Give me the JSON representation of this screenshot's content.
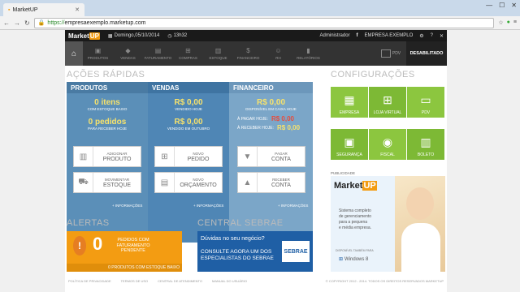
{
  "browser": {
    "tab_title": "MarketUP",
    "url_scheme": "https://",
    "url_host": "empresaexemplo.marketup.com"
  },
  "topbar": {
    "logo_text": "Market",
    "logo_up": "UP",
    "date": "Domingo,05/10/2014",
    "time": "13h32",
    "user": "Administrador",
    "company": "EMPRESA EXEMPLO"
  },
  "nav": {
    "items": [
      "PRODUTOS",
      "VENDAS",
      "FATURAMENTO",
      "COMPRAS",
      "ESTOQUE",
      "FINANCEIRO",
      "RH",
      "RELATÓRIOS"
    ],
    "pdv": "PDV",
    "desabilitado": "DESABILITADO"
  },
  "acoes": {
    "title": "AÇÕES RÁPIDAS",
    "produtos": {
      "header": "PRODUTOS",
      "itens_value": "0 itens",
      "itens_label": "COM ESTOQUE BAIXO",
      "pedidos_value": "0 pedidos",
      "pedidos_label": "PARA RECEBER HOJE",
      "btn1_small": "ADICIONAR",
      "btn1_big": "PRODUTO",
      "btn2_small": "MOVIMENTAR",
      "btn2_big": "ESTOQUE",
      "info": "+ INFORMAÇÕES"
    },
    "vendas": {
      "header": "VENDAS",
      "hoje_value": "R$ 0,00",
      "hoje_label": "VENDIDO HOJE",
      "mes_value": "R$ 0,00",
      "mes_label": "VENDIDO EM OUTUBRO",
      "btn1_small": "NOVO",
      "btn1_big": "PEDIDO",
      "btn2_small": "NOVO",
      "btn2_big": "ORÇAMENTO",
      "info": "+ INFORMAÇÕES"
    },
    "financeiro": {
      "header": "FINANCEIRO",
      "caixa_value": "R$ 0,00",
      "caixa_label": "DISPONÍVEL EM CAIXA HOJE",
      "pagar_label": "À PAGAR HOJE:",
      "pagar_value": "R$ 0,00",
      "receber_label": "À RECEBER HOJE:",
      "receber_value": "R$ 0,00",
      "btn1_small": "PAGAR",
      "btn1_big": "CONTA",
      "btn2_small": "RECEBER",
      "btn2_big": "CONTA",
      "info": "+ INFORMAÇÕES"
    }
  },
  "config": {
    "title": "CONFIGURAÇÕES",
    "tiles": [
      "EMPRESA",
      "LOJA VIRTUAL",
      "PDV",
      "SEGURANÇA",
      "FISCAL",
      "BOLETO"
    ]
  },
  "alertas": {
    "title": "ALERTAS",
    "count": "0",
    "text1": "PEDIDOS COM",
    "text2": "FATURAMENTO",
    "text3": "PENDENTE",
    "bottom": "0 PRODUTOS COM ESTOQUE BAIXO"
  },
  "sebrae": {
    "title": "CENTRAL SEBRAE",
    "question": "Dúvidas no seu negócio?",
    "cta1": "CONSULTE AGORA UM DOS",
    "cta2": "ESPECIALISTAS DO SEBRAE",
    "logo": "SEBRAE"
  },
  "ad": {
    "label": "PUBLICIDADE",
    "brand": "Market",
    "brand_up": "UP",
    "text1": "Sistema completo",
    "text2": "de gerenciamento",
    "text3": "para a pequena",
    "text4": "e média empresa.",
    "small": "DISPONÍVEL TAMBÉM PARA",
    "win": "Windows 8"
  },
  "footer": {
    "links": [
      "POLÍTICA DE PRIVACIDADE",
      "TERMOS DE USO",
      "CENTRAL DE ATENDIMENTO",
      "MANUAL DO USUÁRIO"
    ],
    "copyright": "© COPYRIGHT 2012 - 2014. TODOS OS DIREITOS RESERVADOS MARKETUP"
  },
  "colors": {
    "produtos": "#5b8fb8",
    "vendas": "#4f86b5",
    "financeiro": "#7ba6c8",
    "config_green": "#8cc63f",
    "alert": "#f39c12",
    "sebrae": "#1f5fa5"
  }
}
